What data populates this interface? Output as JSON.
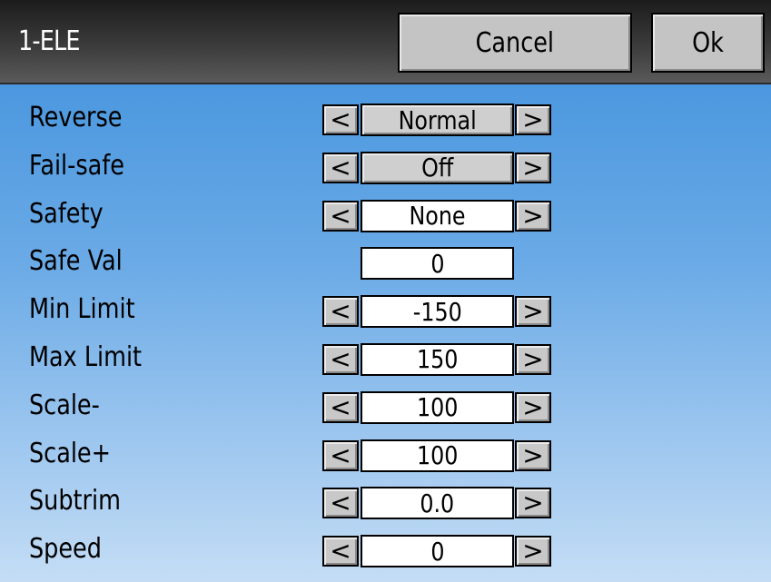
{
  "header": {
    "title": "1-ELE",
    "cancel_label": "Cancel",
    "ok_label": "Ok"
  },
  "icons": {
    "left_arrow": "<",
    "right_arrow": ">"
  },
  "colors": {
    "title_bar": "#2f2f2f",
    "background_top": "#3d8fdc",
    "background_bottom": "#c4ddf5",
    "button_gray": "#c8c8c8"
  },
  "rows": [
    {
      "label": "Reverse",
      "value": "Normal"
    },
    {
      "label": "Fail-safe",
      "value": "Off"
    },
    {
      "label": "Safety",
      "value": "None"
    },
    {
      "label": "Safe Val",
      "value": "0"
    },
    {
      "label": "Min Limit",
      "value": "-150"
    },
    {
      "label": "Max Limit",
      "value": "150"
    },
    {
      "label": "Scale-",
      "value": "100"
    },
    {
      "label": "Scale+",
      "value": "100"
    },
    {
      "label": "Subtrim",
      "value": "0.0"
    },
    {
      "label": "Speed",
      "value": "0"
    }
  ]
}
